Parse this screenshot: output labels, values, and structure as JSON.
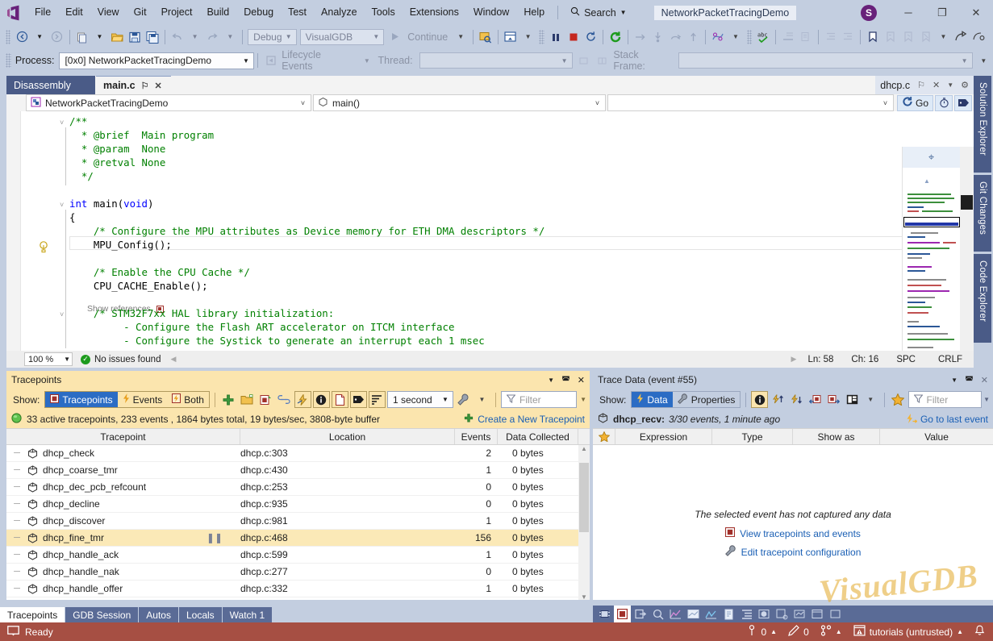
{
  "titlebar": {
    "menus": [
      "File",
      "Edit",
      "View",
      "Git",
      "Project",
      "Build",
      "Debug",
      "Test",
      "Analyze",
      "Tools",
      "Extensions",
      "Window",
      "Help"
    ],
    "search_label": "Search",
    "project_name": "NetworkPacketTracingDemo",
    "avatar_initial": "S",
    "minimize": "─",
    "maximize": "❐",
    "close": "✕"
  },
  "toolbar1": {
    "config_value": "Debug",
    "platform_value": "VisualGDB",
    "continue_label": "Continue"
  },
  "toolbar2": {
    "process_label": "Process:",
    "process_value": "[0x0] NetworkPacketTracingDemo",
    "lifecycle_label": "Lifecycle Events",
    "thread_label": "Thread:",
    "thread_value": ""
  },
  "editor": {
    "tabs": [
      {
        "label": "Disassembly",
        "active": false
      },
      {
        "label": "main.c",
        "active": true
      }
    ],
    "pin_glyph": "⚐",
    "close_glyph": "✕",
    "right_doc": "dhcp.c",
    "nav_project": "NetworkPacketTracingDemo",
    "nav_member": "main()",
    "nav_third": "",
    "go_label": "Go",
    "show_references": "Show references,",
    "code_lines": [
      "/**",
      "  * @brief  Main program",
      "  * @param  None",
      "  * @retval None",
      "  */",
      "int main(void)",
      "{",
      "    /* Configure the MPU attributes as Device memory for ETH DMA descriptors */",
      "    MPU_Config();",
      "",
      "    /* Enable the CPU Cache */",
      "    CPU_CACHE_Enable();",
      "",
      "    /* STM32F7xx HAL library initialization:",
      "         - Configure the Flash ART accelerator on ITCM interface",
      "         - Configure the Systick to generate an interrupt each 1 msec"
    ],
    "status": {
      "zoom": "100 %",
      "issues": "No issues found",
      "line": "Ln: 58",
      "col": "Ch: 16",
      "spaces": "SPC",
      "eol": "CRLF"
    }
  },
  "vertical_tabs": [
    "Solution Explorer",
    "Git Changes",
    "Code Explorer"
  ],
  "tracepoints_panel": {
    "title": "Tracepoints",
    "show_label": "Show:",
    "segments": [
      {
        "label": "Tracepoints",
        "active": true
      },
      {
        "label": "Events",
        "active": false
      },
      {
        "label": "Both",
        "active": false
      }
    ],
    "interval_value": "1 second",
    "filter_placeholder": "Filter",
    "summary": "33 active tracepoints, 233 events , 1864 bytes total, 19 bytes/sec, 3808-byte buffer",
    "create_link": "Create a New Tracepoint",
    "columns": [
      "Tracepoint",
      "Location",
      "Events",
      "Data Collected"
    ],
    "rows": [
      {
        "name": "dhcp_check",
        "location": "dhcp.c:303",
        "events": "2",
        "data": "0 bytes",
        "selected": false,
        "paused": false
      },
      {
        "name": "dhcp_coarse_tmr",
        "location": "dhcp.c:430",
        "events": "1",
        "data": "0 bytes",
        "selected": false,
        "paused": false
      },
      {
        "name": "dhcp_dec_pcb_refcount",
        "location": "dhcp.c:253",
        "events": "0",
        "data": "0 bytes",
        "selected": false,
        "paused": false
      },
      {
        "name": "dhcp_decline",
        "location": "dhcp.c:935",
        "events": "0",
        "data": "0 bytes",
        "selected": false,
        "paused": false
      },
      {
        "name": "dhcp_discover",
        "location": "dhcp.c:981",
        "events": "1",
        "data": "0 bytes",
        "selected": false,
        "paused": false
      },
      {
        "name": "dhcp_fine_tmr",
        "location": "dhcp.c:468",
        "events": "156",
        "data": "0 bytes",
        "selected": true,
        "paused": true
      },
      {
        "name": "dhcp_handle_ack",
        "location": "dhcp.c:599",
        "events": "1",
        "data": "0 bytes",
        "selected": false,
        "paused": false
      },
      {
        "name": "dhcp_handle_nak",
        "location": "dhcp.c:277",
        "events": "0",
        "data": "0 bytes",
        "selected": false,
        "paused": false
      },
      {
        "name": "dhcp_handle_offer",
        "location": "dhcp.c:332",
        "events": "1",
        "data": "0 bytes",
        "selected": false,
        "paused": false
      }
    ]
  },
  "trace_data_panel": {
    "title": "Trace Data (event #55)",
    "show_label": "Show:",
    "segments": [
      {
        "label": "Data",
        "active": true
      },
      {
        "label": "Properties",
        "active": false
      }
    ],
    "filter_placeholder": "Filter",
    "event_name": "dhcp_recv:",
    "event_info": "3/30 events, 1 minute ago",
    "goto_last": "Go to last event",
    "columns": [
      "Expression",
      "Type",
      "Show as",
      "Value"
    ],
    "empty_message": "The selected event has not captured any data",
    "action_view": "View tracepoints and events",
    "action_edit": "Edit tracepoint configuration"
  },
  "bottom_tabs": [
    "Tracepoints",
    "GDB Session",
    "Autos",
    "Locals",
    "Watch 1"
  ],
  "statusbar": {
    "ready": "Ready",
    "errors": "0",
    "pencil": "0",
    "repo": "tutorials (untrusted)"
  },
  "watermark": "VisualGDB",
  "colors": {
    "chrome": "#c3cee0",
    "accent_blue": "#4a5b87",
    "status_red": "#a64f43",
    "panel_gold": "#fbe5ae",
    "selection": "#fbe9b7"
  }
}
